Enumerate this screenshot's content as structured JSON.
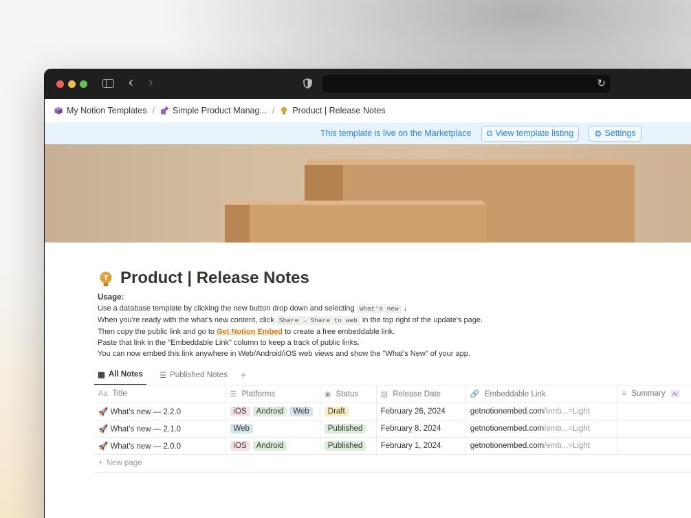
{
  "breadcrumb": [
    {
      "label": "My Notion Templates"
    },
    {
      "label": "Simple Product Manag..."
    },
    {
      "label": "Product | Release Notes"
    }
  ],
  "banner": {
    "message": "This template is live on the Marketplace",
    "view_listing": "View template listing",
    "settings": "Settings"
  },
  "page": {
    "title": "Product | Release Notes",
    "usage_label": "Usage:",
    "lines": {
      "l1a": "Use a database template by clicking the new button drop down and selecting",
      "l1code": "What's new",
      "l1b": "↓",
      "l2a": "When you're ready with the what's new content, click",
      "l2code": "Share → Share to web",
      "l2b": "in the top right of the update's page.",
      "l3a": "Then copy the public link and go to",
      "l3link": "Get Notion Embed",
      "l3b": "to create a free embeddable link.",
      "l4": "Paste that link in the \"Embeddable Link\" column to keep a track of public links.",
      "l5": "You can now embed this link anywhere in Web/Android/iOS web views and show the \"What's New\" of your app."
    }
  },
  "tabs": [
    {
      "label": "All Notes",
      "active": true
    },
    {
      "label": "Published Notes",
      "active": false
    }
  ],
  "table": {
    "columns": {
      "title": "Title",
      "title_prefix": "Aa",
      "platforms": "Platforms",
      "status": "Status",
      "release_date": "Release Date",
      "embeddable_link": "Embeddable Link",
      "summary": "Summary",
      "summary_badge": "AI"
    },
    "rows": [
      {
        "title": "What's new — 2.2.0",
        "platforms": [
          "iOS",
          "Android",
          "Web"
        ],
        "status": "Draft",
        "release_date": "February 26, 2024",
        "link_domain": "getnotionembed.com",
        "link_rest": "/emb...=Light"
      },
      {
        "title": "What's new — 2.1.0",
        "platforms": [
          "Web"
        ],
        "status": "Published",
        "release_date": "February 8, 2024",
        "link_domain": "getnotionembed.com",
        "link_rest": "/emb...=Light"
      },
      {
        "title": "What's new — 2.0.0",
        "platforms": [
          "iOS",
          "Android"
        ],
        "status": "Published",
        "release_date": "February 1, 2024",
        "link_domain": "getnotionembed.com",
        "link_rest": "/emb...=Light"
      }
    ],
    "new_page": "New page"
  },
  "colors": {
    "accent_blue": "#2383e2",
    "link_orange": "#d9730d",
    "titlebar": "#1f1f1f"
  }
}
